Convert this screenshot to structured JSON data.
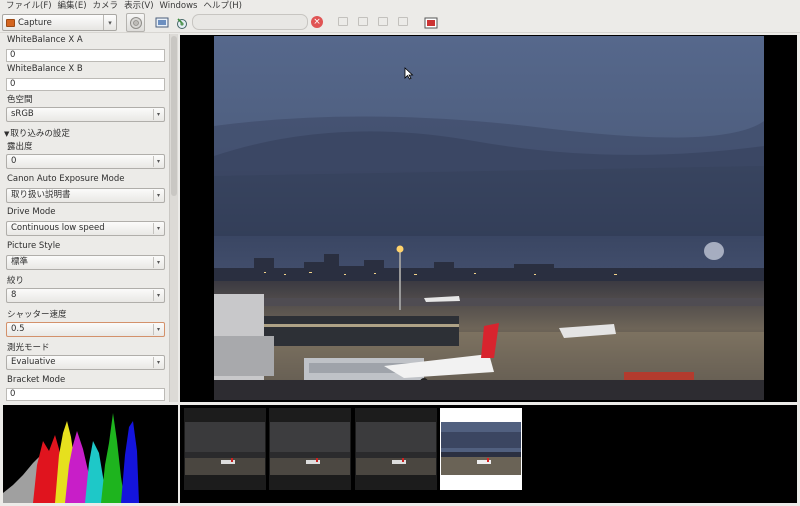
{
  "menubar": [
    {
      "id": "file",
      "label": "ファイル(F)"
    },
    {
      "id": "edit",
      "label": "編集(E)"
    },
    {
      "id": "camera",
      "label": "カメラ"
    },
    {
      "id": "view",
      "label": "表示(V)"
    },
    {
      "id": "windows",
      "label": "Windows"
    },
    {
      "id": "help",
      "label": "ヘルプ(H)"
    }
  ],
  "toolbar": {
    "mode_label": "Capture",
    "search_value": ""
  },
  "properties": {
    "wb_x_label": "WhiteBalance X A",
    "wb_x_value": "0",
    "wb_y_label": "WhiteBalance X B",
    "wb_y_value": "0",
    "colorspace_label": "色空間",
    "colorspace_value": "sRGB",
    "capture_section": "取り込みの設定",
    "exposure_label": "露出度",
    "exposure_value": "0",
    "ae_mode_label": "Canon Auto Exposure Mode",
    "ae_mode_value": "取り扱い説明書",
    "drive_mode_label": "Drive Mode",
    "drive_mode_value": "Continuous low speed",
    "picture_style_label": "Picture Style",
    "picture_style_value": "標準",
    "aperture_label": "絞り",
    "aperture_value": "8",
    "shutter_label": "シャッター速度",
    "shutter_value": "0.5",
    "metering_label": "測光モード",
    "metering_value": "Evaluative",
    "bracket_label": "Bracket Mode",
    "bracket_value": "0"
  },
  "histogram": {
    "colors": {
      "red": "#e0141e",
      "yellow": "#e6e01e",
      "green": "#1eb41e",
      "blue": "#1414dc",
      "magenta": "#c81ec8",
      "cyan": "#1ec8c8",
      "gray": "#a0a0a0"
    }
  },
  "filmstrip": {
    "count": 4,
    "selected_index": 3
  }
}
